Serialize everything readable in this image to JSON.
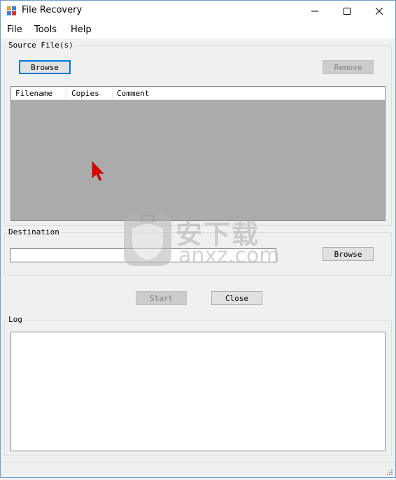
{
  "window": {
    "title": "File Recovery",
    "controls": [
      "minimize",
      "maximize",
      "close"
    ]
  },
  "menu": {
    "items": [
      "File",
      "Tools",
      "Help"
    ]
  },
  "source_group": {
    "label": "Source File(s)",
    "browse_label": "Browse",
    "remove_label": "Remove",
    "columns": [
      "Filename",
      "Copies",
      "Comment"
    ]
  },
  "destination_group": {
    "label": "Destination",
    "value": "",
    "browse_label": "Browse"
  },
  "actions": {
    "start_label": "Start",
    "close_label": "Close"
  },
  "log_group": {
    "label": "Log"
  },
  "watermark": {
    "chinese": "安下载",
    "domain": "anxz.com"
  },
  "colors": {
    "accent": "#0078d7",
    "list_background": "#ababab",
    "cursor": "#e00000"
  }
}
